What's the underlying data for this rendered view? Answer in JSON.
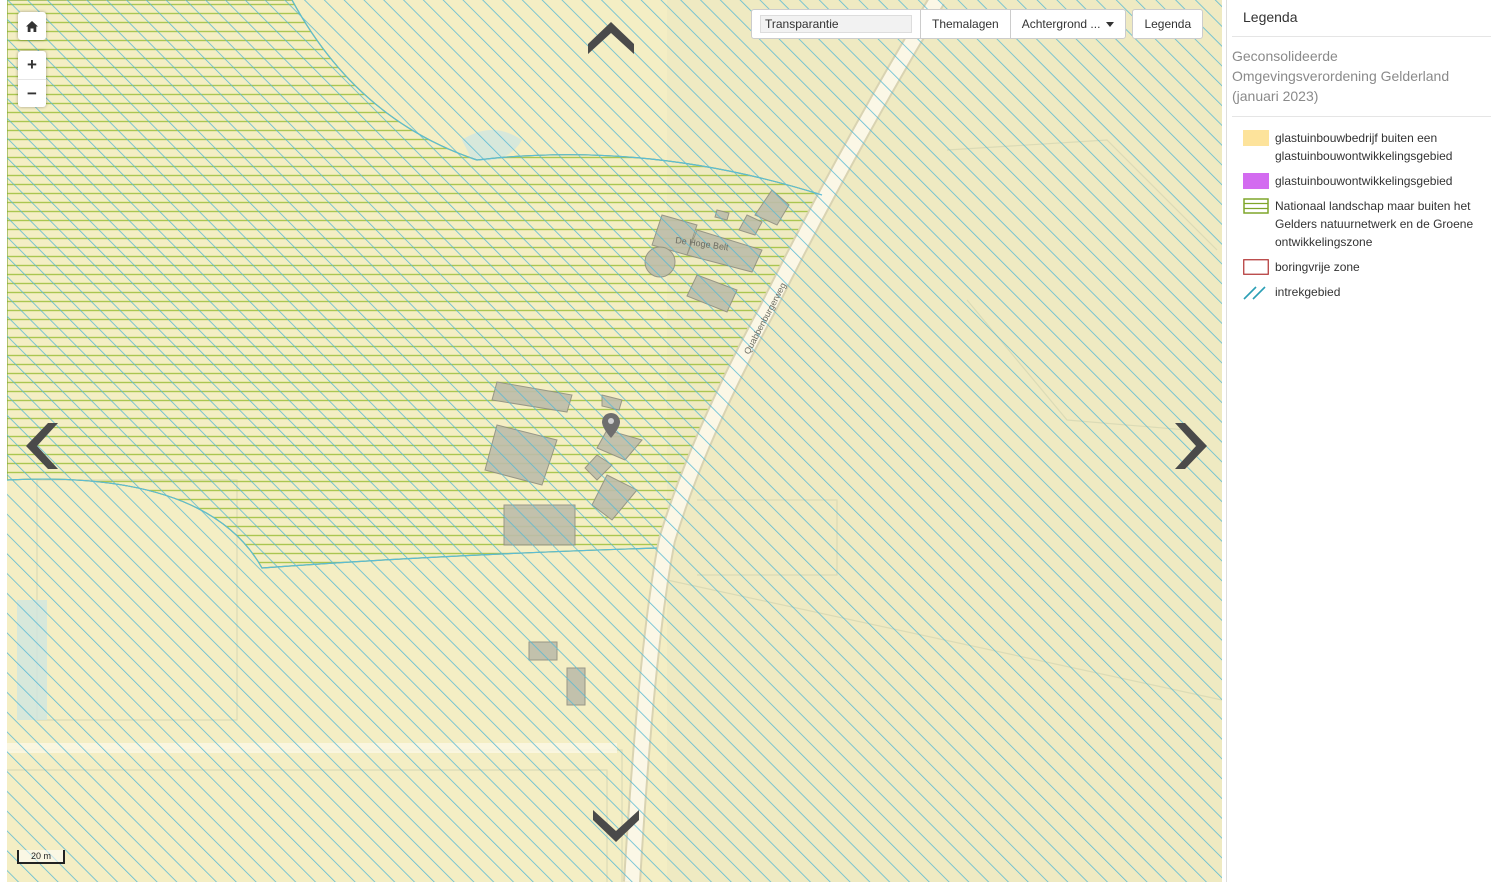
{
  "toolbar": {
    "transparency_value": "Transparantie",
    "themalagen_label": "Themalagen",
    "achtergrond_label": "Achtergrond ...",
    "legenda_label": "Legenda"
  },
  "map": {
    "place_label": "De Hoge Belt",
    "road_label": "Quabbenburgerweg",
    "scale_label": "20 m",
    "zoom_in_label": "+",
    "zoom_out_label": "−"
  },
  "legend": {
    "title": "Legenda",
    "subtitle": "Geconsolideerde Omgevingsverordening Gelderland (januari 2023)",
    "items": [
      {
        "label": "glastuinbouwbedrijf buiten een glastuinbouwontwikkelingsgebied",
        "swatch": "fill",
        "color": "#fde39b"
      },
      {
        "label": "glastuinbouwontwikkelingsgebied",
        "swatch": "fill",
        "color": "#d36bf0"
      },
      {
        "label": "Nationaal landschap maar buiten het Gelders natuurnetwerk en de Groene ontwikkelingszone",
        "swatch": "hlines",
        "color": "#7fa52a"
      },
      {
        "label": "boringvrije zone",
        "swatch": "outline",
        "color": "#b03030"
      },
      {
        "label": "intrekgebied",
        "swatch": "diag",
        "color": "#2a9fb5"
      }
    ]
  },
  "colors": {
    "map_background": "#f4eec4",
    "diagonal_hatch": "#57b8d4",
    "horizontal_hatch": "#a7c44a",
    "building": "#bdbdaa",
    "road": "#fbf7e6"
  },
  "icons": [
    "home-icon",
    "chevron-up-icon",
    "chevron-down-icon",
    "chevron-left-icon",
    "chevron-right-icon",
    "location-pin-icon",
    "caret-down-icon"
  ]
}
